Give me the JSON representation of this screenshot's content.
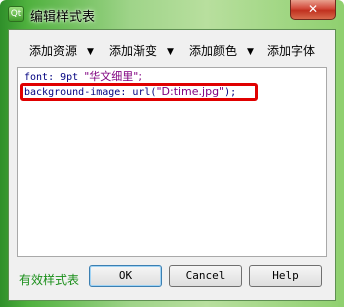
{
  "window": {
    "title": "编辑样式表",
    "icon_text": "Qt",
    "close_glyph": "✕"
  },
  "toolbar": {
    "items": [
      {
        "label": "添加资源",
        "arrow": "▼"
      },
      {
        "label": "添加渐变",
        "arrow": "▼"
      },
      {
        "label": "添加颜色",
        "arrow": "▼"
      },
      {
        "label": "添加字体",
        "arrow": ""
      }
    ]
  },
  "editor": {
    "line1": {
      "prop": "font: 9pt ",
      "value": "\"华文细里\";"
    },
    "line2": {
      "prop": "background-image: url(",
      "value": "\"D:time.jpg\"",
      "tail": ");"
    },
    "highlight_color": "#e00000"
  },
  "footer": {
    "status": "有效样式表",
    "status_color": "#1a8f1a",
    "ok_label": "OK",
    "cancel_label": "Cancel",
    "help_label": "Help"
  }
}
